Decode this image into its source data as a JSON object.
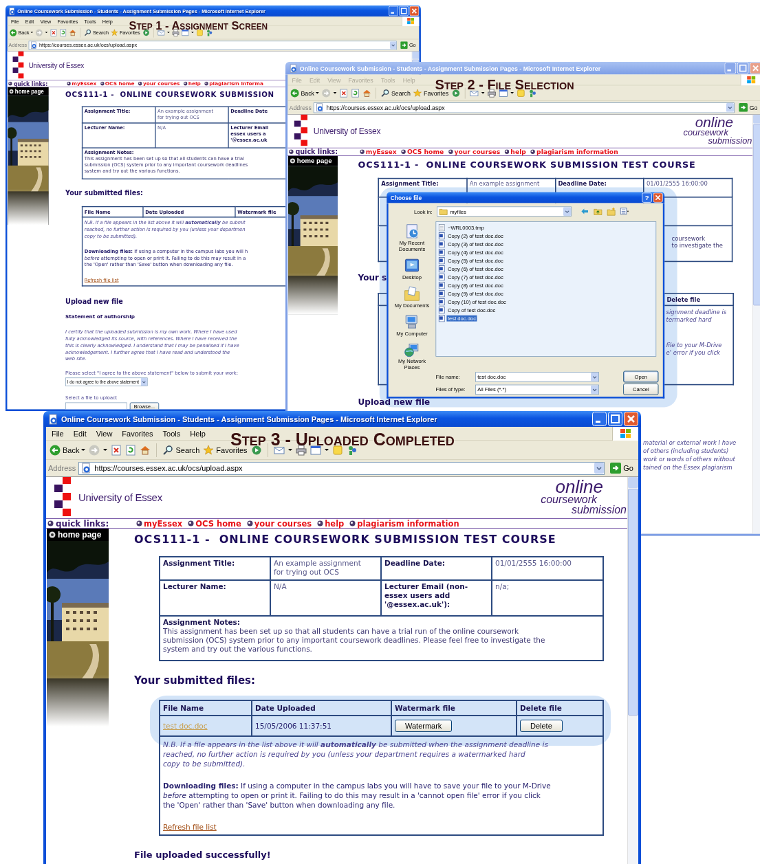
{
  "windows": [
    {
      "active": true,
      "title": "Online Coursework Submission - Students - Assignment Submission Pages - Microsoft Internet Explorer",
      "caption": "Step 1 - Assignment Screen",
      "menu": [
        {
          "label": "File",
          "disabled": false
        },
        {
          "label": "Edit",
          "disabled": false
        },
        {
          "label": "View",
          "disabled": false
        },
        {
          "label": "Favorites",
          "disabled": false
        },
        {
          "label": "Tools",
          "disabled": false
        },
        {
          "label": "Help",
          "disabled": false
        }
      ],
      "toolbar": {
        "back": "Back",
        "search": "Search",
        "favorites": "Favorites"
      },
      "address": {
        "label": "Address",
        "url": "https://courses.essex.ac.uk/ocs/upload.aspx",
        "go": "Go"
      },
      "page": {
        "university": "University of Essex",
        "quick_links_label": "quick links:",
        "quick_links": [
          "myEssex",
          "OCS home",
          "your courses",
          "help",
          "plagiarism informa"
        ],
        "home_page": "home page",
        "photo": {
          "kind": "picture"
        },
        "heading": "OCS111-1 -  ONLINE COURSEWORK SUBMISSION",
        "sections": [
          {
            "kind": "details",
            "rows": [
              {
                "cells": [
                  {
                    "kind": "label",
                    "lines": [
                      "Assignment Title:"
                    ]
                  },
                  {
                    "kind": "value",
                    "lines": [
                      "An example assignment",
                      "for trying out OCS"
                    ]
                  },
                  {
                    "kind": "label",
                    "lines": [
                      "Deadline Date"
                    ]
                  }
                ]
              },
              {
                "cells": [
                  {
                    "kind": "label",
                    "lines": [
                      "Lecturer Name:"
                    ]
                  },
                  {
                    "kind": "value",
                    "lines": [
                      "N/A"
                    ]
                  },
                  {
                    "kind": "label",
                    "lines": [
                      "Lecturer Email",
                      "essex users a",
                      "'@essex.ac.uk"
                    ]
                  }
                ]
              }
            ],
            "notes": {
              "label": "Assignment Notes:",
              "lines": [
                "This assignment has been set up so that all students can have a trial",
                "submission (OCS) system prior to any important coursework deadlines",
                "system and try out the various functions."
              ]
            }
          },
          {
            "kind": "subheading",
            "text": "Your submitted files:"
          },
          {
            "kind": "files",
            "columns": [
              "File Name",
              "Date Uploaded",
              "Watermark file"
            ],
            "notes": [
              {
                "kind": "italic",
                "lines": [
                  "N.B. If a file appears in the list above it will **automatically** be submit",
                  "reached, no further action is required by you (unless your departmen",
                  "copy to be submitted)."
                ]
              },
              {
                "kind": "plain",
                "lines": [
                  "**Downloading files:** If using a computer in the campus labs you will h",
                  "*before* attempting to open or print it. Failing to do this may result in a",
                  "the 'Open' rather than 'Save' button when downloading any file."
                ]
              }
            ],
            "refresh": "Refresh file list"
          },
          {
            "kind": "upload",
            "heading": "Upload new file",
            "statement_heading": "Statement of authorship",
            "statement": [
              "I certify that the uploaded submission is my own work. Where I have used",
              "fully acknowledged its source, with references. Where I have received the",
              "this is clearly acknowledged. I understand that I may be penalised if I have",
              "acknowledgement. I further agree that I have read and understood the",
              "web site."
            ],
            "prompt": "Please select \"I agree to the above statement\" below to submit your work:",
            "agreement": "I do not agree to the above statement",
            "file_prompt": "Select a file to upload:",
            "browse": "Browse..."
          }
        ]
      }
    },
    {
      "active": false,
      "title": "Online Coursework Submission - Students - Assignment Submission Pages - Microsoft Internet Explorer",
      "caption": "Step 2 - File Selection",
      "menu": [
        {
          "label": "File",
          "disabled": true
        },
        {
          "label": "Edit",
          "disabled": true
        },
        {
          "label": "View",
          "disabled": true
        },
        {
          "label": "Favorites",
          "disabled": true
        },
        {
          "label": "Tools",
          "disabled": true
        },
        {
          "label": "Help",
          "disabled": true
        }
      ],
      "toolbar": {
        "back": "Back",
        "search": "Search",
        "favorites": "Favorites"
      },
      "address": {
        "label": "Address",
        "url": "https://courses.essex.ac.uk/ocs/upload.aspx",
        "go": "Go"
      },
      "page": {
        "university": "University of Essex",
        "brand": [
          "online",
          "coursework",
          "submission"
        ],
        "quick_links_label": "quick links:",
        "quick_links": [
          "myEssex",
          "OCS home",
          "your courses",
          "help",
          "plagiarism information"
        ],
        "home_page": "home page",
        "photo": {
          "kind": "picture"
        },
        "heading": "OCS111-1 -  ONLINE COURSEWORK SUBMISSION TEST COURSE",
        "sections": [
          {
            "kind": "details-covered",
            "first_row": [
              {
                "kind": "label",
                "lines": [
                  "Assignment Title:"
                ]
              },
              {
                "kind": "value",
                "lines": [
                  "An example assignment"
                ]
              },
              {
                "kind": "label",
                "lines": [
                  "Deadline Date:"
                ]
              },
              {
                "kind": "value",
                "lines": [
                  "01/01/2555 16:00:00"
                ]
              }
            ],
            "notes_tail": [
              "coursework",
              "to investigate the"
            ]
          },
          {
            "kind": "subheading",
            "text": "Your s"
          },
          {
            "kind": "files-covered",
            "last_column": "Delete file",
            "notes_tail": [
              [
                "signment deadline is",
                "termarked hard"
              ],
              [
                "file to your M-Drive",
                "e' error if you click"
              ]
            ]
          },
          {
            "kind": "upload-covered",
            "heading": "Upload new file",
            "statement_tail": [
              "material or external work I have",
              "of others (including students)",
              "work or words of others without",
              "tained on the Essex plagiarism"
            ]
          }
        ]
      },
      "dialog": {
        "title": "Choose file",
        "help": "?",
        "highlighted": true,
        "look_in_label": "Look in:",
        "look_in": "myfiles",
        "places": [
          {
            "label": "My Recent Documents",
            "kind": "recent"
          },
          {
            "label": "Desktop",
            "kind": "desktop"
          },
          {
            "label": "My Documents",
            "kind": "documents"
          },
          {
            "label": "My Computer",
            "kind": "computer"
          },
          {
            "label": "My Network Places",
            "kind": "network"
          }
        ],
        "files": [
          {
            "name": "~WRL0003.tmp",
            "kind": "tmp",
            "selected": false
          },
          {
            "name": "Copy (2) of test doc.doc",
            "kind": "doc",
            "selected": false
          },
          {
            "name": "Copy (3) of test doc.doc",
            "kind": "doc",
            "selected": false
          },
          {
            "name": "Copy (4) of test doc.doc",
            "kind": "doc",
            "selected": false
          },
          {
            "name": "Copy (5) of test doc.doc",
            "kind": "doc",
            "selected": false
          },
          {
            "name": "Copy (6) of test doc.doc",
            "kind": "doc",
            "selected": false
          },
          {
            "name": "Copy (7) of test doc.doc",
            "kind": "doc",
            "selected": false
          },
          {
            "name": "Copy (8) of test doc.doc",
            "kind": "doc",
            "selected": false
          },
          {
            "name": "Copy (9) of test doc.doc",
            "kind": "doc",
            "selected": false
          },
          {
            "name": "Copy (10) of test doc.doc",
            "kind": "doc",
            "selected": false
          },
          {
            "name": "Copy of test doc.doc",
            "kind": "doc",
            "selected": false
          },
          {
            "name": "test doc.doc",
            "kind": "doc",
            "selected": true
          }
        ],
        "file_name_label": "File name:",
        "file_name": "test doc.doc",
        "file_type_label": "Files of type:",
        "file_type": "All Files (*.*)",
        "buttons": [
          "Open",
          "Cancel"
        ]
      }
    },
    {
      "active": true,
      "title": "Online Coursework Submission - Students - Assignment Submission Pages - Microsoft Internet Explorer",
      "caption": "Step 3 - Uploaded Completed",
      "menu": [
        {
          "label": "File",
          "disabled": false
        },
        {
          "label": "Edit",
          "disabled": false
        },
        {
          "label": "View",
          "disabled": false
        },
        {
          "label": "Favorites",
          "disabled": false
        },
        {
          "label": "Tools",
          "disabled": false
        },
        {
          "label": "Help",
          "disabled": false
        }
      ],
      "toolbar": {
        "back": "Back",
        "search": "Search",
        "favorites": "Favorites"
      },
      "address": {
        "label": "Address",
        "url": "https://courses.essex.ac.uk/ocs/upload.aspx",
        "go": "Go"
      },
      "page": {
        "university": "University of Essex",
        "brand": [
          "online",
          "coursework",
          "submission"
        ],
        "quick_links_label": "quick links:",
        "quick_links": [
          "myEssex",
          "OCS home",
          "your courses",
          "help",
          "plagiarism information"
        ],
        "home_page": "home page",
        "photo": {
          "kind": "picture"
        },
        "heading": "OCS111-1 -  ONLINE COURSEWORK SUBMISSION TEST COURSE",
        "sections": [
          {
            "kind": "details",
            "rows": [
              {
                "cells": [
                  {
                    "kind": "label",
                    "lines": [
                      "Assignment Title:"
                    ]
                  },
                  {
                    "kind": "value",
                    "lines": [
                      "An example assignment",
                      "for trying out OCS"
                    ]
                  },
                  {
                    "kind": "label",
                    "lines": [
                      "Deadline Date:"
                    ]
                  },
                  {
                    "kind": "value",
                    "lines": [
                      "01/01/2555 16:00:00"
                    ]
                  }
                ]
              },
              {
                "cells": [
                  {
                    "kind": "label",
                    "lines": [
                      "Lecturer Name:"
                    ]
                  },
                  {
                    "kind": "value",
                    "lines": [
                      "N/A"
                    ]
                  },
                  {
                    "kind": "label",
                    "lines": [
                      "Lecturer Email (non-",
                      "essex users add",
                      "'@essex.ac.uk'):"
                    ]
                  },
                  {
                    "kind": "value",
                    "lines": [
                      "n/a;"
                    ]
                  }
                ]
              }
            ],
            "notes": {
              "label": "Assignment Notes:",
              "lines": [
                "This assignment has been set up so that all students can have a trial run of the online coursework",
                "submission (OCS) system prior to any important coursework deadlines. Please feel free to investigate the",
                "system and try out the various functions."
              ]
            }
          },
          {
            "kind": "subheading",
            "text": "Your submitted files:"
          },
          {
            "kind": "files",
            "columns": [
              "File Name",
              "Date Uploaded",
              "Watermark file",
              "Delete file"
            ],
            "rows": [
              {
                "file": "test doc.doc",
                "date": "15/05/2006 11:37:51",
                "watermark": "Watermark",
                "delete": "Delete",
                "highlighted": true
              }
            ],
            "notes": [
              {
                "kind": "italic",
                "lines": [
                  "N.B. If a file appears in the list above it will **automatically** be submitted when the assignment deadline is",
                  "reached, no further action is required by you (unless your department requires a watermarked hard",
                  "copy to be submitted)."
                ]
              },
              {
                "kind": "plain",
                "lines": [
                  "**Downloading files:** If using a computer in the campus labs you will have to save your file to your M-Drive",
                  "*before* attempting to open or print it. Failing to do this may result in a 'cannot open file' error if you click",
                  "the 'Open' rather than 'Save' button when downloading any file."
                ]
              }
            ],
            "refresh": "Refresh file list"
          },
          {
            "kind": "message",
            "text": "File uploaded successfully!"
          }
        ]
      }
    }
  ]
}
